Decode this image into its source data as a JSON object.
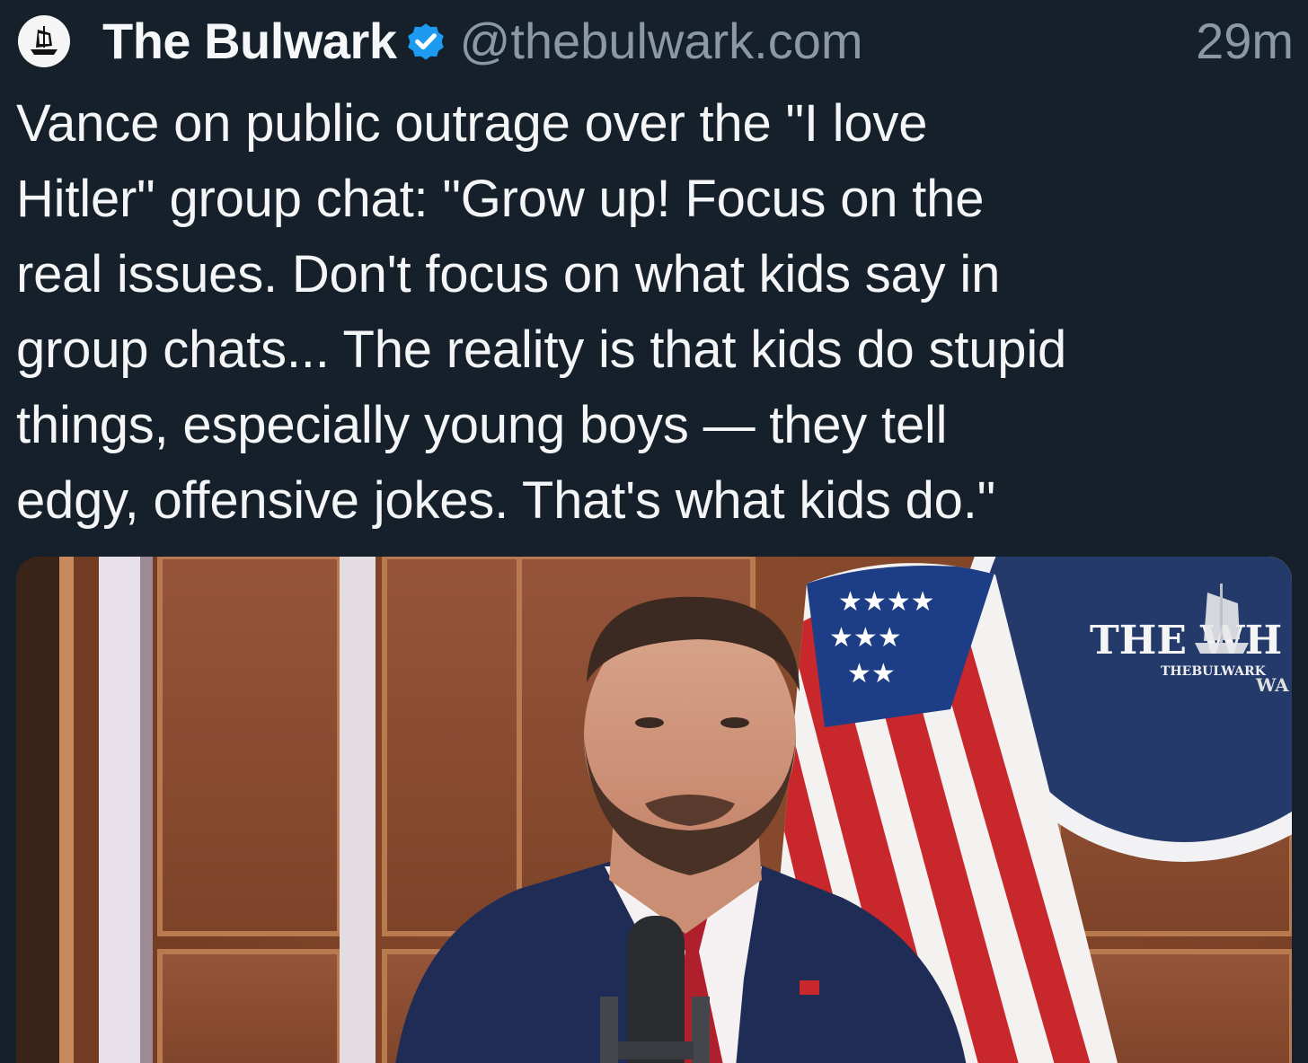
{
  "post": {
    "author": {
      "display_name": "The Bulwark",
      "handle": "@thebulwark.com",
      "avatar_icon": "bulwark-ship-logo-icon",
      "verified_icon": "verified-badge-icon",
      "verified_color": "#1d9bf0"
    },
    "timestamp": "29m",
    "text": "Vance on public outrage over the \"I love\nHitler\" group chat: \"Grow up! Focus on the\nreal issues. Don't focus on what kids say in\ngroup chats... The reality is that kids do stupid\nthings, especially young boys — they tell\nedgy, offensive jokes. That's what kids do.\"",
    "media": {
      "watermark_large": "THE  WH",
      "watermark_small": "THEBULWARK",
      "seal_partial": "WA"
    }
  },
  "colors": {
    "background": "#15202b",
    "text": "#f3f5f7",
    "muted": "#8b98a5"
  }
}
